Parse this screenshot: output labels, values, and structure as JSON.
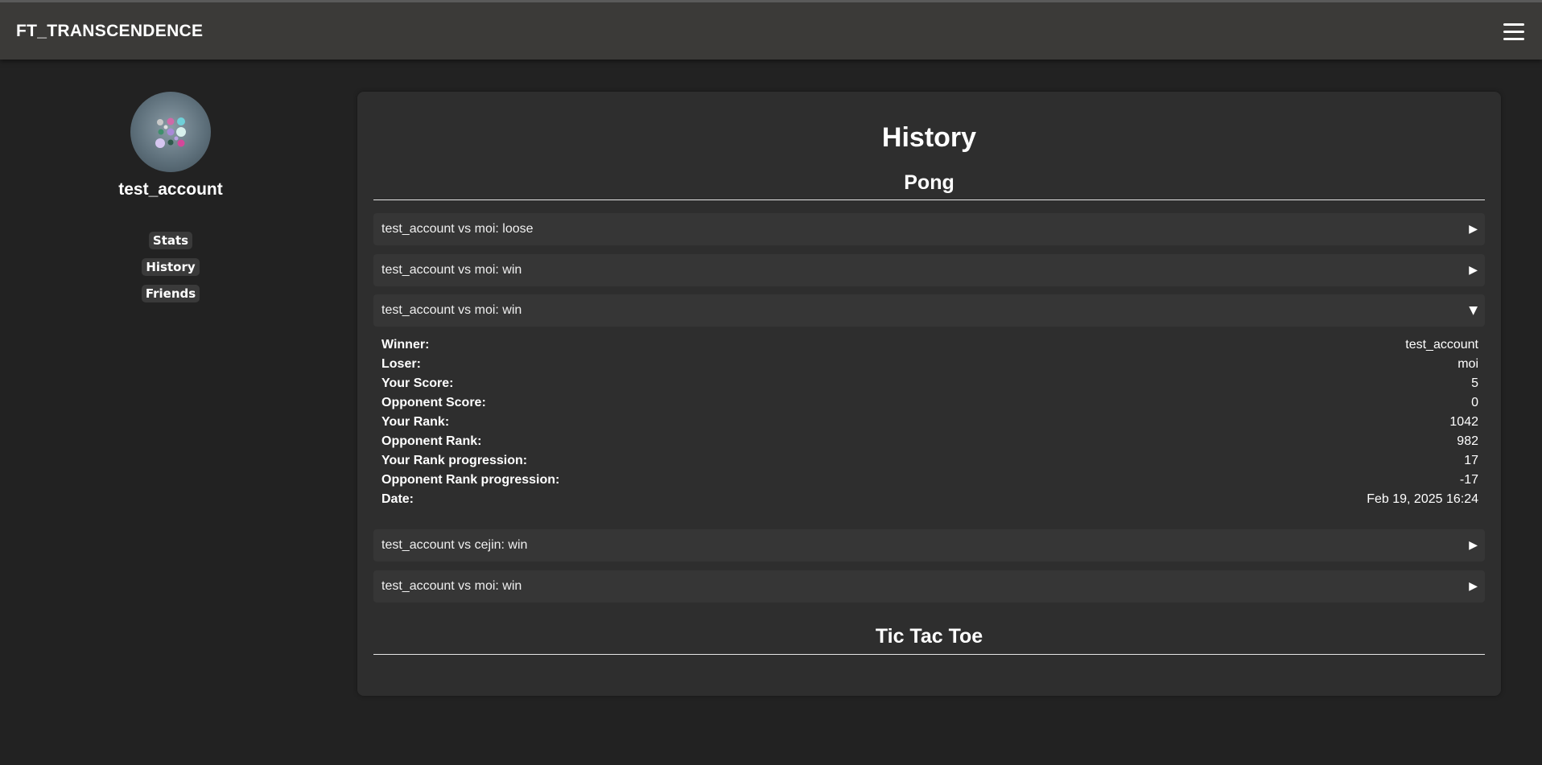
{
  "header": {
    "brand": "FT_TRANSCENDENCE",
    "menu_icon": "hamburger-menu-icon"
  },
  "profile": {
    "username": "test_account",
    "avatar_icon": "avatar-image"
  },
  "nav": {
    "items": [
      {
        "label": "Stats"
      },
      {
        "label": "History"
      },
      {
        "label": "Friends"
      }
    ]
  },
  "history": {
    "title": "History",
    "pong": {
      "title": "Pong",
      "matches": [
        {
          "label": "test_account vs moi: loose",
          "arrow": "▶",
          "expanded": false
        },
        {
          "label": "test_account vs moi: win",
          "arrow": "▶",
          "expanded": false
        },
        {
          "label": "test_account vs moi: win",
          "arrow": "▼",
          "expanded": true
        },
        {
          "label": "test_account vs cejin: win",
          "arrow": "▶",
          "expanded": false
        },
        {
          "label": "test_account vs moi: win",
          "arrow": "▶",
          "expanded": false
        }
      ],
      "expanded_details": [
        {
          "key": "Winner:",
          "value": "test_account"
        },
        {
          "key": "Loser:",
          "value": "moi"
        },
        {
          "key": "Your Score:",
          "value": "5"
        },
        {
          "key": "Opponent Score:",
          "value": "0"
        },
        {
          "key": "Your Rank:",
          "value": "1042"
        },
        {
          "key": "Opponent Rank:",
          "value": "982"
        },
        {
          "key": "Your Rank progression:",
          "value": "17"
        },
        {
          "key": "Opponent Rank progression:",
          "value": "-17"
        },
        {
          "key": "Date:",
          "value": "Feb 19, 2025 16:24"
        }
      ]
    },
    "tictactoe": {
      "title": "Tic Tac Toe"
    }
  },
  "colors": {
    "background": "#222222",
    "topbar": "#3b3a38",
    "panel": "#2e2e2e",
    "row": "#363636"
  }
}
